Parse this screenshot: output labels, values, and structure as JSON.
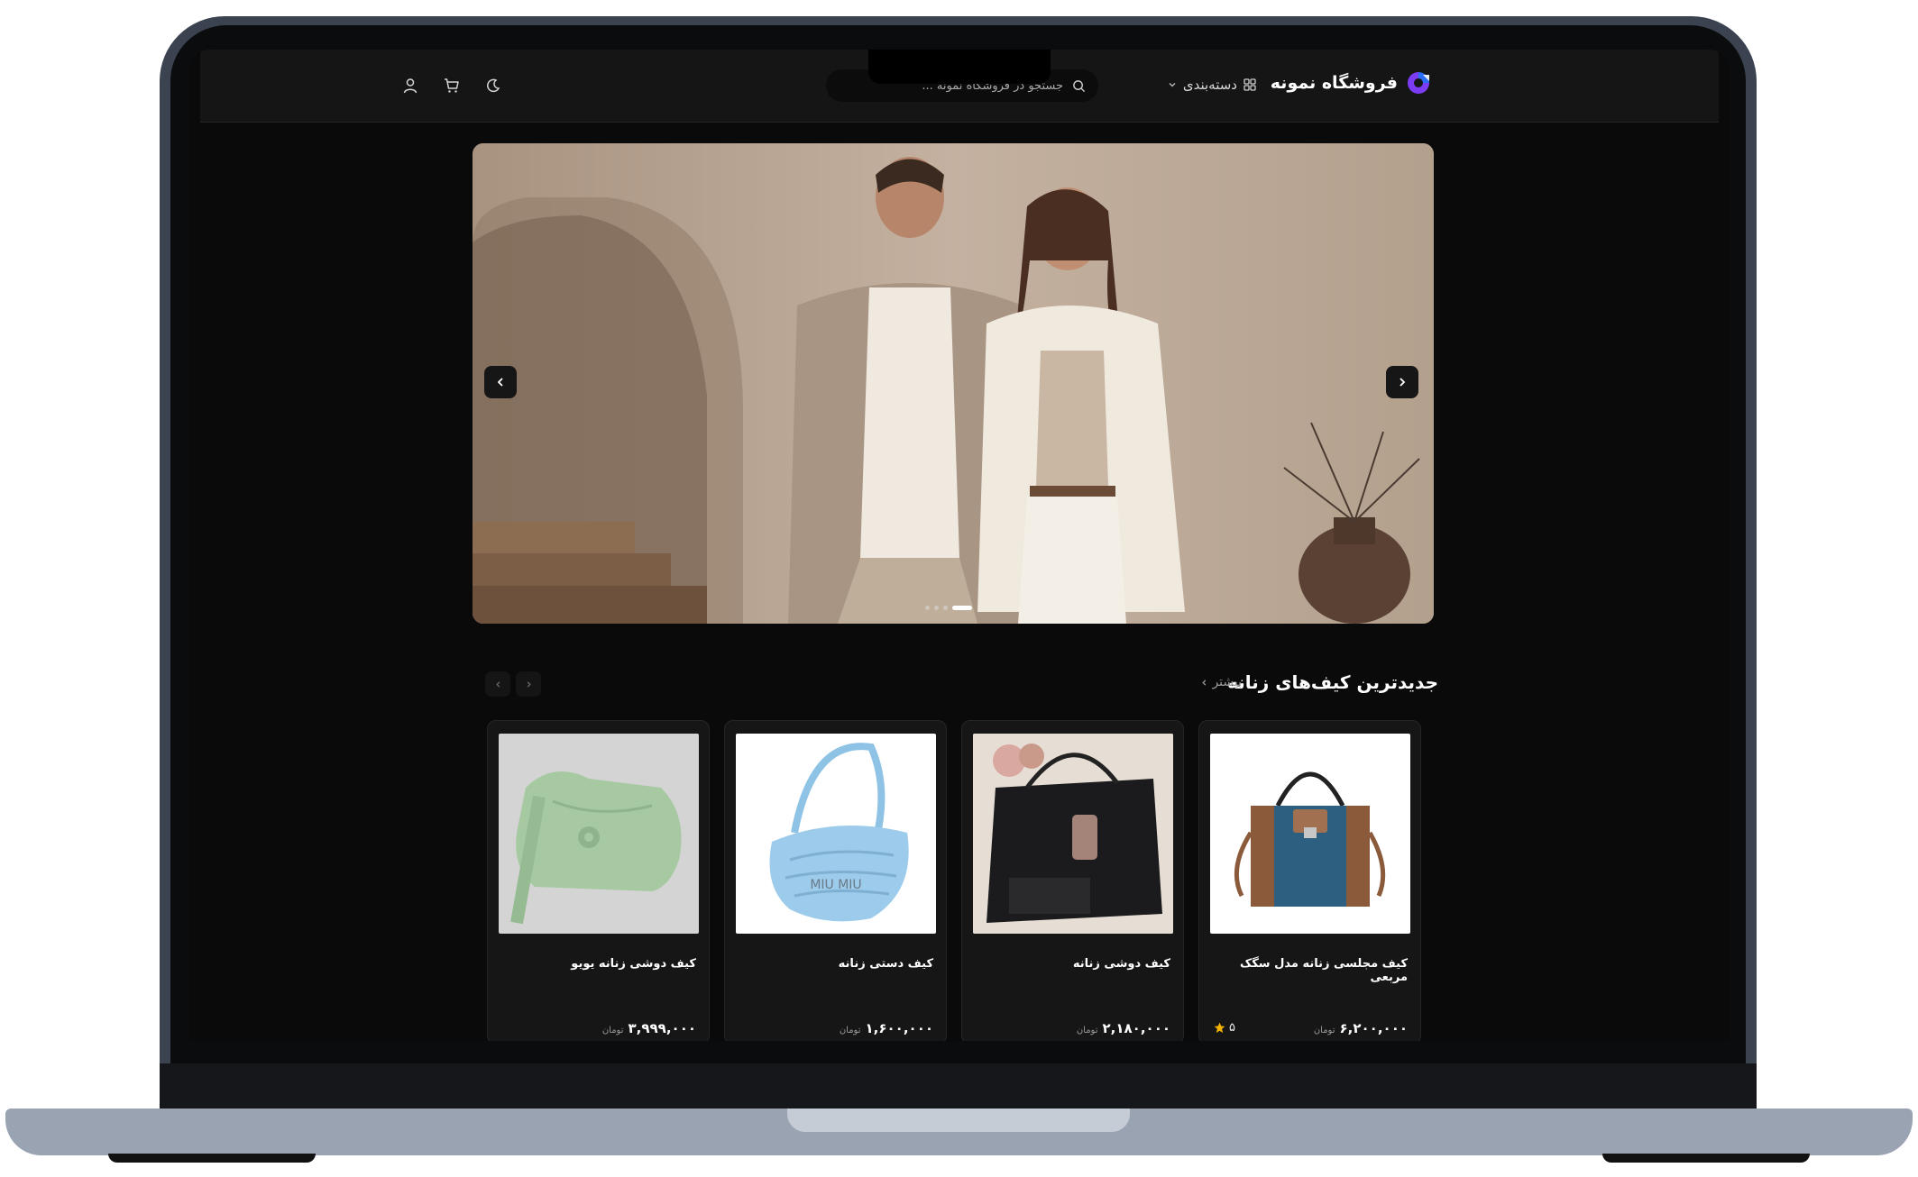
{
  "header": {
    "store_name": "فروشگاه نمونه",
    "category_label": "دسته‌بندی",
    "search_placeholder": "جستجو در فروشگاه نمونه ..."
  },
  "banner": {
    "slide_count": 4,
    "active_slide": 4
  },
  "section": {
    "title": "جدیدترین کیف‌های زنانه",
    "more_label": "بیشتر"
  },
  "products": [
    {
      "name": "کیف مجلسی زنانه مدل سگک مربعی",
      "price": "۶,۲۰۰,۰۰۰",
      "unit": "تومان",
      "rating": "۵"
    },
    {
      "name": "کیف دوشی زنانه",
      "price": "۲,۱۸۰,۰۰۰",
      "unit": "تومان"
    },
    {
      "name": "کیف دستی زنانه",
      "price": "۱,۶۰۰,۰۰۰",
      "unit": "تومان"
    },
    {
      "name": "کیف دوشی زنانه یویو",
      "price": "۳,۹۹۹,۰۰۰",
      "unit": "تومان"
    }
  ],
  "colors": {
    "background": "#0a0a0a",
    "header": "#151515",
    "card": "#161616",
    "accent": "#7b3cf2",
    "star": "#f5b301"
  }
}
